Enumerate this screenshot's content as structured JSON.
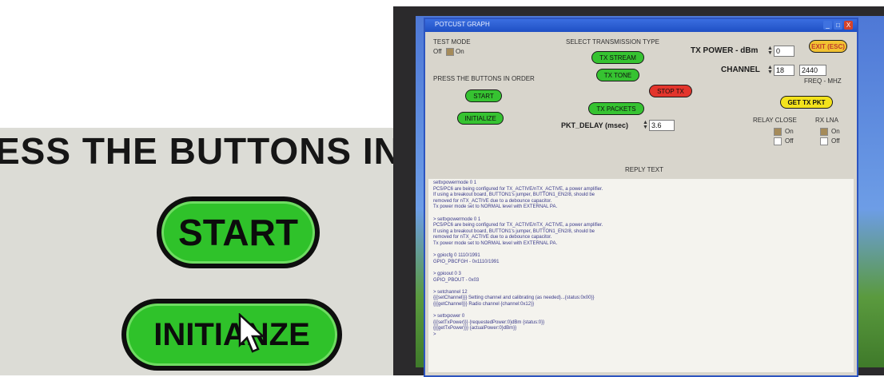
{
  "zoom": {
    "heading": "ESS THE BUTTONS IN",
    "start_label": "START",
    "initialize_label": "INITIANZE"
  },
  "window": {
    "title": "POTCUST GRAPH",
    "controls": {
      "minimize": "_",
      "maximize": "□",
      "close": "X"
    }
  },
  "test_mode": {
    "label": "TEST MODE",
    "off": "Off",
    "on": "On"
  },
  "press_buttons_label": "PRESS THE BUTTONS IN ORDER",
  "start_button": "START",
  "initialize_button": "INITIALIZE",
  "transmission": {
    "label": "SELECT TRANSMISSION TYPE",
    "tx_stream": "TX STREAM",
    "tx_tone": "TX TONE",
    "stop_tx": "STOP TX",
    "tx_packets": "TX PACKETS"
  },
  "pkt_delay": {
    "label": "PKT_DELAY (msec)",
    "value": "3.6"
  },
  "tx_power": {
    "label": "TX POWER - dBm",
    "value": "0"
  },
  "exit_button": "EXIT (ESC)",
  "channel": {
    "label": "CHANNEL",
    "value": "18",
    "freq_value": "2440",
    "freq_label": "FREQ - MHZ"
  },
  "get_tx_pkt_button": "GET TX PKT",
  "relay_close": {
    "label": "RELAY CLOSE",
    "on": "On",
    "off": "Off"
  },
  "rx_lna": {
    "label": "RX LNA",
    "on": "On",
    "off": "Off"
  },
  "reply": {
    "label": "REPLY TEXT",
    "lines": [
      "settxpowermode 0 1",
      "PC5/PC6 are being configured for TX_ACTIVE/nTX_ACTIVE, a power amplifier.",
      "If using a breakout board, BUTTON1's jumper, BUTTON1_EN2/8, should be",
      "removed for nTX_ACTIVE due to a debounce capacitor.",
      "Tx power mode set to NORMAL level with EXTERNAL PA.",
      "",
      "> settxpowermode 0 1",
      "PC5/PC6 are being configured for TX_ACTIVE/nTX_ACTIVE, a power amplifier.",
      "If using a breakout board, BUTTON1's jumper, BUTTON1_EN2/8, should be",
      "removed for nTX_ACTIVE due to a debounce capacitor.",
      "Tx power mode set to NORMAL level with EXTERNAL PA.",
      "",
      "> gpiocfg 0 1110/1991",
      "GPIO_PBCFGH - 0x1110/1991",
      "",
      "> gpioout 0 3",
      "GPIO_PBOUT - 0x03",
      "",
      "> setchannel 12",
      "{{{setChannel}}} Setting channel and calibrating (as needed)...{status:0x00}}",
      "{{{getChannel}}} Radio channel {channel:0x12}}",
      "",
      "> settxpower 0",
      "{{{setTxPower}}} {requestedPower:0}dBm {status:0}}",
      "{{{getTxPower}}} {actualPower:0}dBm}}",
      ">"
    ]
  },
  "colors": {
    "button_green": "#36c331",
    "stop_red": "#e3352c",
    "highlight_yellow": "#f3e21c",
    "titlebar_blue": "#2d55c0"
  }
}
